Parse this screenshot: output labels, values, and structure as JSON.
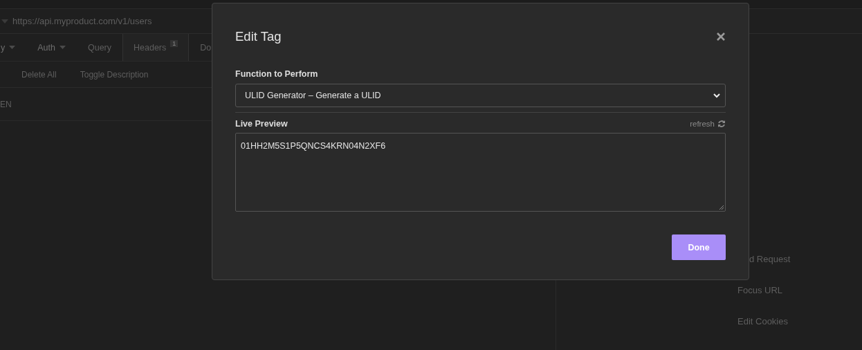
{
  "url_bar": {
    "url": "https://api.myproduct.com/v1/users"
  },
  "request_tabs": [
    {
      "label": "y",
      "kind": "dropdown",
      "selected": false
    },
    {
      "label": "Auth",
      "kind": "dropdown",
      "selected": false
    },
    {
      "label": "Query",
      "kind": "plain",
      "selected": false
    },
    {
      "label": "Headers",
      "kind": "plain",
      "badge": "1",
      "selected": true
    },
    {
      "label": "Do",
      "kind": "plain",
      "selected": false
    }
  ],
  "toolbar": [
    "Delete All",
    "Toggle Description"
  ],
  "table": {
    "column_1": "EN"
  },
  "shortcuts": [
    "d Request",
    "Focus URL",
    "Edit Cookies"
  ],
  "dialog": {
    "title": "Edit Tag",
    "function_label": "Function to Perform",
    "function_value": "ULID Generator – Generate a ULID",
    "preview_label": "Live Preview",
    "refresh": "refresh",
    "preview_value": "01HH2M5S1P5QNCS4KRN04N2XF6",
    "done": "Done"
  }
}
